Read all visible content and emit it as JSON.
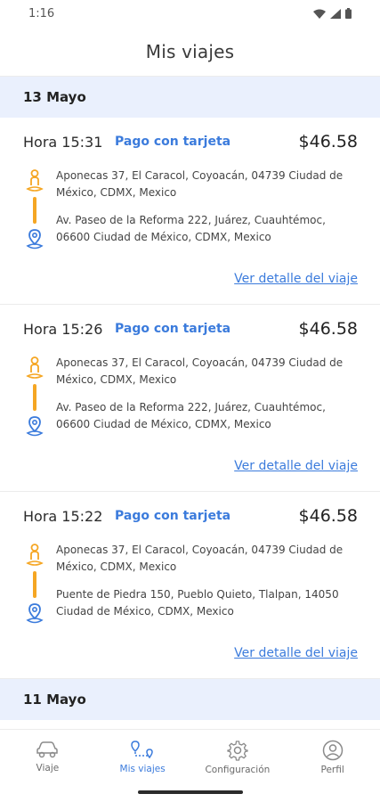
{
  "status": {
    "time": "1:16"
  },
  "header": {
    "title": "Mis viajes"
  },
  "sections": [
    {
      "date": "13 Mayo",
      "trips": [
        {
          "time": "Hora 15:31",
          "payment": "Pago con tarjeta",
          "price": "$46.58",
          "origin": "Aponecas 37, El Caracol, Coyoacán, 04739 Ciudad de México, CDMX, Mexico",
          "destination": "Av. Paseo de la Reforma 222, Juárez, Cuauhtémoc, 06600 Ciudad de México, CDMX, Mexico",
          "link": "Ver detalle del viaje"
        },
        {
          "time": "Hora 15:26",
          "payment": "Pago con tarjeta",
          "price": "$46.58",
          "origin": "Aponecas 37, El Caracol, Coyoacán, 04739 Ciudad de México, CDMX, Mexico",
          "destination": "Av. Paseo de la Reforma 222, Juárez, Cuauhtémoc, 06600 Ciudad de México, CDMX, Mexico",
          "link": "Ver detalle del viaje"
        },
        {
          "time": "Hora 15:22",
          "payment": "Pago con tarjeta",
          "price": "$46.58",
          "origin": "Aponecas 37, El Caracol, Coyoacán, 04739 Ciudad de México, CDMX, Mexico",
          "destination": "Puente de Piedra 150, Pueblo Quieto, Tlalpan, 14050 Ciudad de México, CDMX, Mexico",
          "link": "Ver detalle del viaje"
        }
      ]
    },
    {
      "date": "11 Mayo"
    }
  ],
  "nav": {
    "items": [
      {
        "label": "Viaje",
        "icon": "car-icon"
      },
      {
        "label": "Mis viajes",
        "icon": "route-icon"
      },
      {
        "label": "Configuración",
        "icon": "gear-icon"
      },
      {
        "label": "Perfil",
        "icon": "user-icon"
      }
    ],
    "active_index": 1
  },
  "colors": {
    "accent": "#3b7bdc",
    "route_line": "#f5a623",
    "date_bg": "#eaf0fd"
  }
}
